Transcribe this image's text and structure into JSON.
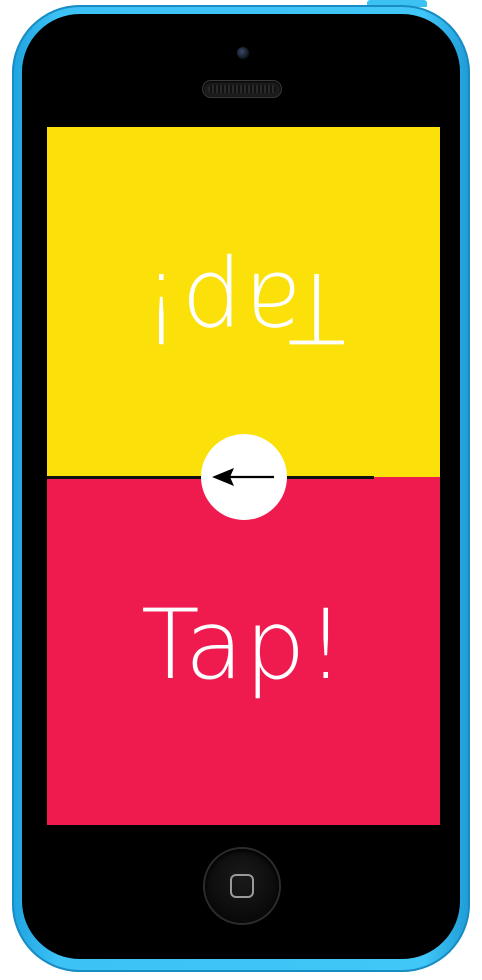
{
  "game": {
    "top_player_label": "Tap!",
    "bottom_player_label": "Tap!",
    "top_color": "#fbe00a",
    "bottom_color": "#ef1a4d",
    "center_button_icon": "left-arrow-icon"
  },
  "device": {
    "body_color": "#40c6f7",
    "home_button_icon": "home-square-icon"
  }
}
